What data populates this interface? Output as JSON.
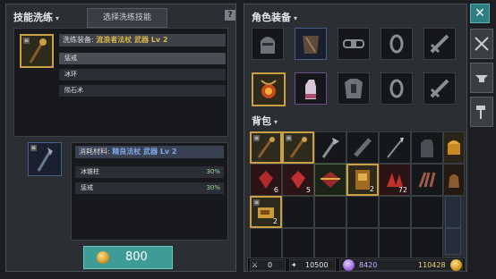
{
  "left": {
    "title": "技能洗练",
    "tab_label": "选择洗练技能",
    "help_icon": "?",
    "equipment_prefix": "洗练装备:",
    "equipment_name": "流浪者法杖 武器 Lv 2",
    "skills": [
      "惩戒",
      "冰环",
      "陨石术"
    ],
    "material_prefix": "消耗材料:",
    "material_name": "精良法杖 武器 Lv 2",
    "material_options": [
      {
        "name": "冰锥柱",
        "pct": "30%"
      },
      {
        "name": "惩戒",
        "pct": "30%"
      }
    ],
    "cost": "800"
  },
  "right": {
    "equip_title": "角色装备",
    "bag_title": "背包",
    "bag_counts": {
      "r2c1": "6",
      "r2c2": "5",
      "r2c4": "2",
      "r2c5": "72",
      "r3c1": "2"
    },
    "status": {
      "v1": "0",
      "v2": "10500",
      "v3": "8420",
      "v4": "110428"
    }
  },
  "close_label": "✕",
  "colors": {
    "accent": "#3f9b95",
    "gold": "#d9b64a",
    "pct": "#9fd39a"
  }
}
